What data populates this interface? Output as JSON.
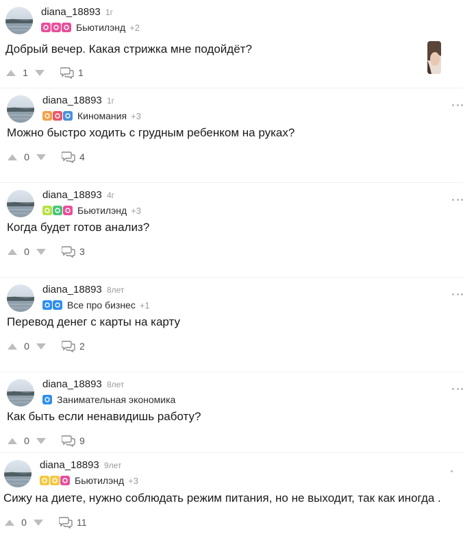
{
  "posts": [
    {
      "author": "diana_18893",
      "age": "1г",
      "community": "Бьютилэнд",
      "community_extra": "+2",
      "badges": [
        "#e8509b",
        "#e8509b",
        "#e8509b"
      ],
      "badge_icons": [
        "scissors-badge-icon",
        "lipstick-badge-icon",
        "dryer-badge-icon"
      ],
      "question": "Добрый вечер. Какая стрижка мне подойдёт?",
      "votes": "1",
      "comments": "1",
      "has_thumbnail": true
    },
    {
      "author": "diana_18893",
      "age": "1г",
      "community": "Киномания",
      "community_extra": "+3",
      "badges": [
        "#f0a24a",
        "#e85a6a",
        "#4a90d9"
      ],
      "badge_icons": [
        "mask-badge-icon",
        "popcorn-badge-icon",
        "film-badge-icon"
      ],
      "question": "Можно быстро ходить с грудным ребенком на руках?",
      "votes": "0",
      "comments": "4",
      "has_thumbnail": false
    },
    {
      "author": "diana_18893",
      "age": "4г",
      "community": "Бьютилэнд",
      "community_extra": "+3",
      "badges": [
        "#b8e04a",
        "#4ac77a",
        "#e8509b"
      ],
      "badge_icons": [
        "mirror-badge-icon",
        "ring-badge-icon",
        "dryer-badge-icon"
      ],
      "question": "Когда будет готов анализ?",
      "votes": "0",
      "comments": "3",
      "has_thumbnail": false
    },
    {
      "author": "diana_18893",
      "age": "8лет",
      "community": "Все про бизнес",
      "community_extra": "+1",
      "badges": [
        "#2f8ef0",
        "#2f8ef0"
      ],
      "badge_icons": [
        "like-badge-icon",
        "handshake-badge-icon"
      ],
      "question": "Перевод денег с карты на карту",
      "votes": "0",
      "comments": "2",
      "has_thumbnail": false
    },
    {
      "author": "diana_18893",
      "age": "8лет",
      "community": "Занимательная экономика",
      "community_extra": "",
      "badges": [
        "#2f8ef0"
      ],
      "badge_icons": [
        "chart-badge-icon"
      ],
      "question": "Как быть если ненавидишь работу?",
      "votes": "0",
      "comments": "9",
      "has_thumbnail": false
    },
    {
      "author": "diana_18893",
      "age": "9лет",
      "community": "Бьютилэнд",
      "community_extra": "+3",
      "badges": [
        "#f5c842",
        "#f5c842",
        "#e8509b"
      ],
      "badge_icons": [
        "hand-badge-icon",
        "bottle-badge-icon",
        "dryer-badge-icon"
      ],
      "question": "Сижу на диете, нужно соблюдать режим питания, но не выходит, так как иногда .",
      "votes": "0",
      "comments": "11",
      "has_thumbnail": false
    }
  ]
}
